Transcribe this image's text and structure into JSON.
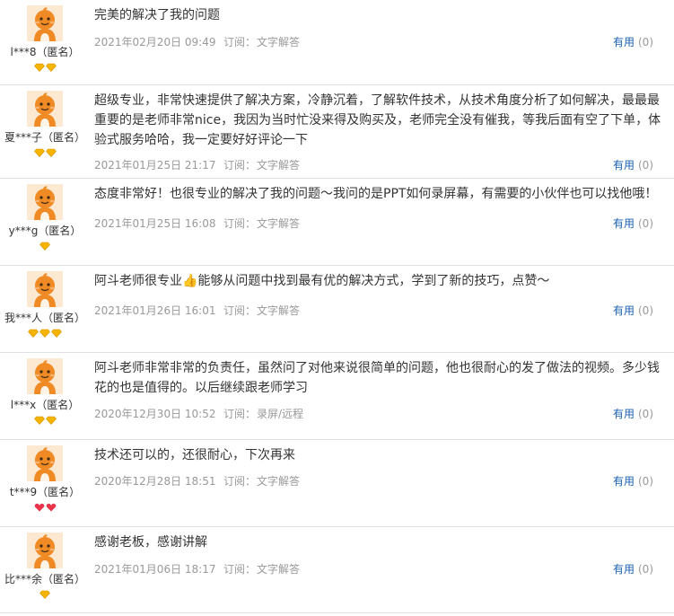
{
  "subscribe_label": "订阅：",
  "helpful_label": "有用",
  "reviews": [
    {
      "username": "l***8（匿名）",
      "text": "完美的解决了我的问题",
      "time": "2021年02月20日 09:49",
      "subscribe": "文字解答",
      "helpful_count": "(0)",
      "badges": [
        "gold",
        "gold"
      ]
    },
    {
      "username": "夏***子（匿名）",
      "text": "超级专业，非常快速提供了解决方案，冷静沉着，了解软件技术，从技术角度分析了如何解决，最最最重要的是老师非常nice，我因为当时忙没来得及购买及，老师完全没有催我，等我后面有空了下单，体验式服务哈哈，我一定要好好评论一下",
      "time": "2021年01月25日 21:17",
      "subscribe": "文字解答",
      "helpful_count": "(0)",
      "badges": [
        "gold",
        "gold"
      ]
    },
    {
      "username": "y***g（匿名）",
      "text": "态度非常好！也很专业的解决了我的问题～我问的是PPT如何录屏幕，有需要的小伙伴也可以找他哦！",
      "time": "2021年01月25日 16:08",
      "subscribe": "文字解答",
      "helpful_count": "(0)",
      "badges": [
        "gold"
      ]
    },
    {
      "username": "我***人（匿名）",
      "text": "阿斗老师很专业👍能够从问题中找到最有优的解决方式，学到了新的技巧，点赞～",
      "time": "2021年01月26日 16:01",
      "subscribe": "文字解答",
      "helpful_count": "(0)",
      "badges": [
        "gold",
        "gold",
        "gold"
      ]
    },
    {
      "username": "l***x（匿名）",
      "text": "阿斗老师非常非常的负责任，虽然问了对他来说很简单的问题，他也很耐心的发了做法的视频。多少钱花的也是值得的。以后继续跟老师学习",
      "time": "2020年12月30日 10:52",
      "subscribe": "录屏/远程",
      "helpful_count": "(0)",
      "badges": [
        "gold",
        "gold"
      ]
    },
    {
      "username": "t***9（匿名）",
      "text": "技术还可以的，还很耐心，下次再来",
      "time": "2020年12月28日 18:51",
      "subscribe": "文字解答",
      "helpful_count": "(0)",
      "badges": [
        "red",
        "red"
      ]
    },
    {
      "username": "比***余（匿名）",
      "text": "感谢老板，感谢讲解",
      "time": "2021年01月06日 18:17",
      "subscribe": "文字解答",
      "helpful_count": "(0)",
      "badges": [
        "gold"
      ]
    }
  ],
  "colors": {
    "gold": "#f5b400",
    "red": "#e8334a",
    "link": "#1a5fb4",
    "meta": "#999999",
    "avatar": "#f08a24"
  }
}
